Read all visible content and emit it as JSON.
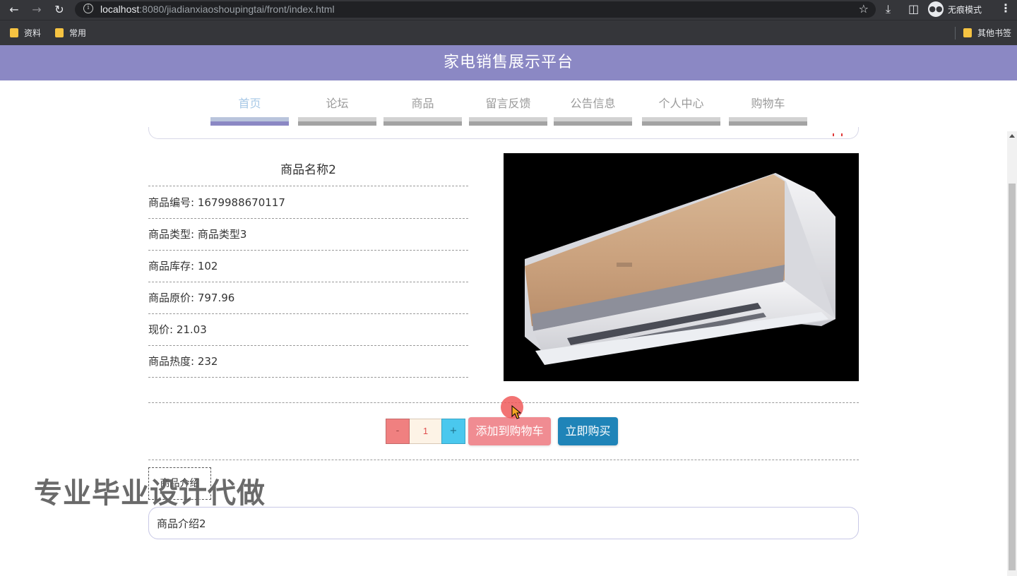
{
  "browser": {
    "url_host": "localhost",
    "url_rest": ":8080/jiadianxiaoshoupingtai/front/index.html",
    "incognito_label": "无痕模式",
    "bookmarks": [
      "资料",
      "常用"
    ],
    "other_bookmarks": "其他书签"
  },
  "site": {
    "title": "家电销售展示平台"
  },
  "nav": {
    "items": [
      "首页",
      "论坛",
      "商品",
      "留言反馈",
      "公告信息",
      "个人中心",
      "购物车"
    ],
    "active": "首页"
  },
  "product": {
    "name": "商品名称2",
    "fields": [
      {
        "label": "商品编号: 1679988670117"
      },
      {
        "label": "商品类型: 商品类型3"
      },
      {
        "label": "商品库存: 102"
      },
      {
        "label": "商品原价: 797.96"
      },
      {
        "label": "现价: 21.03"
      },
      {
        "label": "商品热度: 232"
      }
    ],
    "image_alt": "air-conditioner"
  },
  "purchase": {
    "minus": "-",
    "quantity": "1",
    "plus": "+",
    "add_to_cart": "添加到购物车",
    "buy_now": "立即购买"
  },
  "detail": {
    "tab_label": "商品介绍",
    "description": "商品介绍2"
  },
  "overlay": {
    "watermark": "专业毕业设计代做"
  },
  "colors": {
    "header": "#8b88c4",
    "nav_active_text": "#a7c8e6",
    "cart_button": "#f08c92",
    "buy_button": "#1f84b8",
    "minus_button": "#f08080",
    "plus_button": "#4ac8ee"
  }
}
